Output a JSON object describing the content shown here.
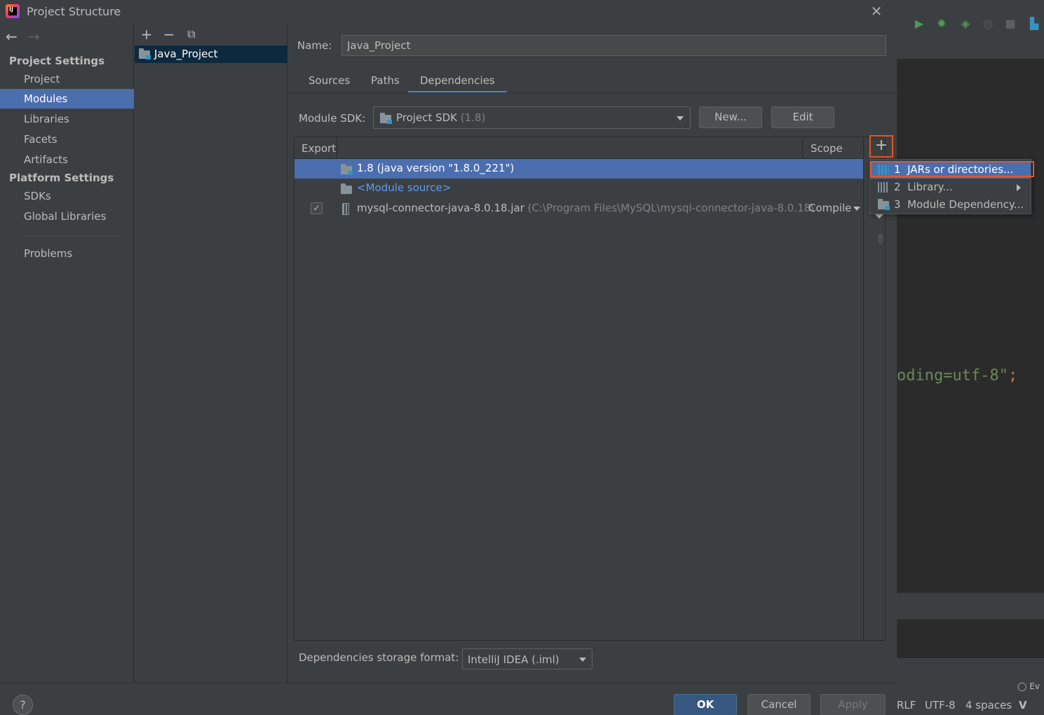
{
  "dialog": {
    "title": "Project Structure",
    "close_icon": "close-icon"
  },
  "nav": {
    "project_settings": "Project Settings",
    "project_items": [
      "Project",
      "Modules",
      "Libraries",
      "Facets",
      "Artifacts"
    ],
    "platform_settings": "Platform Settings",
    "platform_items": [
      "SDKs",
      "Global Libraries"
    ],
    "problems": "Problems",
    "selected": "Modules"
  },
  "modules": {
    "items": [
      "Java_Project"
    ]
  },
  "main": {
    "name_label": "Name:",
    "name_value": "Java_Project",
    "tabs": [
      "Sources",
      "Paths",
      "Dependencies"
    ],
    "active_tab": "Dependencies",
    "sdk_label": "Module SDK:",
    "sdk_value": "Project SDK",
    "sdk_version": "(1.8)",
    "new_button": "New...",
    "edit_button": "Edit"
  },
  "table": {
    "col_export": "Export",
    "col_scope": "Scope",
    "rows": [
      {
        "name": "1.8 (java version \"1.8.0_221\")",
        "selected": true
      },
      {
        "name": "<Module source>"
      },
      {
        "name": "mysql-connector-java-8.0.18.jar",
        "path": "(C:\\Program Files\\MySQL\\mysql-connector-java-8.0.18\\",
        "exported": true,
        "scope": "Compile"
      }
    ]
  },
  "popup": {
    "items": [
      {
        "num": "1",
        "label": "JARs or directories..."
      },
      {
        "num": "2",
        "label": "Library..."
      },
      {
        "num": "3",
        "label": "Module Dependency..."
      }
    ]
  },
  "storage": {
    "label": "Dependencies storage format:",
    "value": "IntelliJ IDEA (.iml)"
  },
  "footer": {
    "help": "?",
    "ok": "OK",
    "cancel": "Cancel",
    "apply": "Apply"
  },
  "ide": {
    "code_fragment": "oding=utf-8\"",
    "code_semicolon": ";",
    "status_line_sep": "RLF",
    "status_encoding": "UTF-8",
    "status_indent": "4 spaces",
    "events": "Ev"
  },
  "colors": {
    "selection": "#4b6eaf",
    "highlight_box": "#e0582a",
    "link": "#589df6",
    "run_green": "#499c54"
  }
}
